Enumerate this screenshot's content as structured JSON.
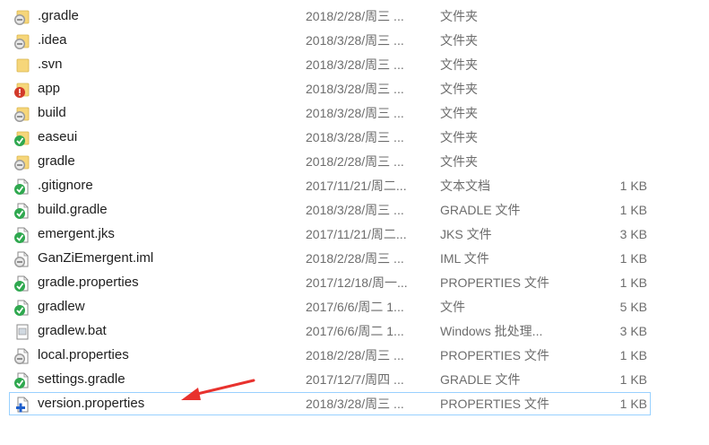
{
  "files": [
    {
      "name": ".gradle",
      "date": "2018/2/28/周三 ...",
      "type": "文件夹",
      "size": "",
      "kind": "folder",
      "overlay": "gray-minus"
    },
    {
      "name": ".idea",
      "date": "2018/3/28/周三 ...",
      "type": "文件夹",
      "size": "",
      "kind": "folder",
      "overlay": "gray-minus"
    },
    {
      "name": ".svn",
      "date": "2018/3/28/周三 ...",
      "type": "文件夹",
      "size": "",
      "kind": "folder",
      "overlay": "none"
    },
    {
      "name": "app",
      "date": "2018/3/28/周三 ...",
      "type": "文件夹",
      "size": "",
      "kind": "folder",
      "overlay": "red-exclamation"
    },
    {
      "name": "build",
      "date": "2018/3/28/周三 ...",
      "type": "文件夹",
      "size": "",
      "kind": "folder",
      "overlay": "gray-minus"
    },
    {
      "name": "easeui",
      "date": "2018/3/28/周三 ...",
      "type": "文件夹",
      "size": "",
      "kind": "folder",
      "overlay": "green-check"
    },
    {
      "name": "gradle",
      "date": "2018/2/28/周三 ...",
      "type": "文件夹",
      "size": "",
      "kind": "folder",
      "overlay": "gray-minus"
    },
    {
      "name": ".gitignore",
      "date": "2017/11/21/周二...",
      "type": "文本文档",
      "size": "1 KB",
      "kind": "file",
      "overlay": "green-check"
    },
    {
      "name": "build.gradle",
      "date": "2018/3/28/周三 ...",
      "type": "GRADLE 文件",
      "size": "1 KB",
      "kind": "file",
      "overlay": "green-check"
    },
    {
      "name": "emergent.jks",
      "date": "2017/11/21/周二...",
      "type": "JKS 文件",
      "size": "3 KB",
      "kind": "file",
      "overlay": "green-check"
    },
    {
      "name": "GanZiEmergent.iml",
      "date": "2018/2/28/周三 ...",
      "type": "IML 文件",
      "size": "1 KB",
      "kind": "file",
      "overlay": "gray-minus"
    },
    {
      "name": "gradle.properties",
      "date": "2017/12/18/周一...",
      "type": "PROPERTIES 文件",
      "size": "1 KB",
      "kind": "file",
      "overlay": "green-check"
    },
    {
      "name": "gradlew",
      "date": "2017/6/6/周二 1...",
      "type": "文件",
      "size": "5 KB",
      "kind": "file",
      "overlay": "green-check"
    },
    {
      "name": "gradlew.bat",
      "date": "2017/6/6/周二 1...",
      "type": "Windows 批处理...",
      "size": "3 KB",
      "kind": "bat",
      "overlay": "none"
    },
    {
      "name": "local.properties",
      "date": "2018/2/28/周三 ...",
      "type": "PROPERTIES 文件",
      "size": "1 KB",
      "kind": "file",
      "overlay": "gray-minus"
    },
    {
      "name": "settings.gradle",
      "date": "2017/12/7/周四 ...",
      "type": "GRADLE 文件",
      "size": "1 KB",
      "kind": "file",
      "overlay": "green-check"
    },
    {
      "name": "version.properties",
      "date": "2018/3/28/周三 ...",
      "type": "PROPERTIES 文件",
      "size": "1 KB",
      "kind": "file",
      "overlay": "blue-plus",
      "selected": true
    }
  ],
  "colors": {
    "folder": "#f6d67a",
    "green-check": "#2fa84f",
    "red-exclamation": "#d23a2a",
    "gray-minus": "#9a9a9a",
    "blue-plus": "#1f5fcc",
    "annotation-arrow": "#e8322e",
    "selection-border": "#99d1ff"
  }
}
